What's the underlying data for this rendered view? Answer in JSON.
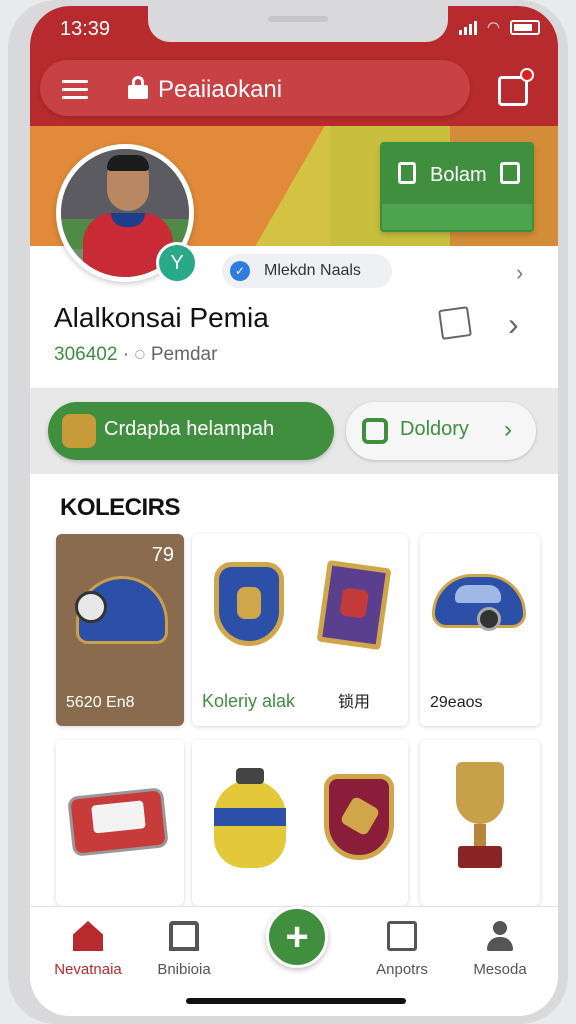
{
  "status_bar": {
    "time": "13:39"
  },
  "header": {
    "search_text": "Peaiiaokani"
  },
  "banner": {
    "button_label": "Bolam"
  },
  "profile": {
    "chip_label": "Mlekdn Naals",
    "name": "Alalkonsai Pemia",
    "id_number": "306402",
    "subtitle": "Pemdar"
  },
  "actions": {
    "primary_label": "Crdapba helampah",
    "secondary_label": "Doldory"
  },
  "collection": {
    "title": "KOLECIRS",
    "featured_count": "79",
    "cards": [
      {
        "name": "helmet-card",
        "footer": "5620 En8"
      },
      {
        "name": "badges-card",
        "footer": "Koleriy alak"
      },
      {
        "name": "badges-card-side",
        "footer": "锁用"
      },
      {
        "name": "car-card",
        "footer": "29eaos"
      }
    ]
  },
  "bottom_nav": {
    "items": [
      {
        "label": "Nevatnaia"
      },
      {
        "label": "Bnibioia"
      },
      {
        "label": "Anpotrs"
      },
      {
        "label": "Mesoda"
      }
    ],
    "fab_label": "+"
  },
  "colors": {
    "brand_red": "#b72a2d",
    "brand_green": "#3f8f3f",
    "gold": "#d0a64b"
  }
}
